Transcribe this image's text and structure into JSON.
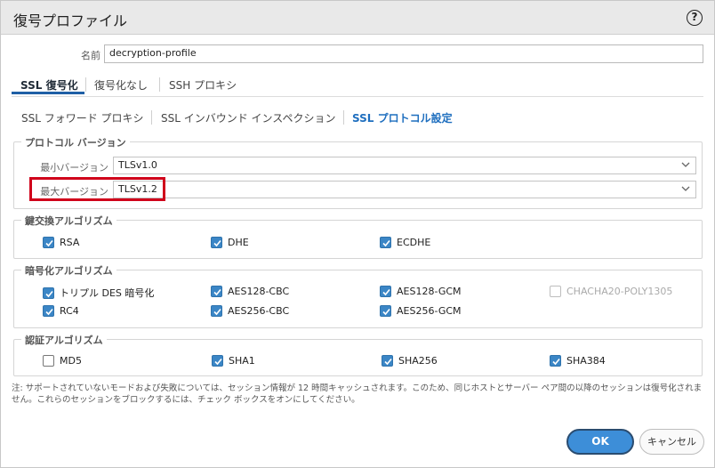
{
  "dialog": {
    "title": "復号プロファイル"
  },
  "name_field": {
    "label": "名前",
    "value": "decryption-profile"
  },
  "tabs": [
    "SSL 復号化",
    "復号化なし",
    "SSH プロキシ"
  ],
  "subtabs": [
    "SSL フォワード プロキシ",
    "SSL インバウンド インスペクション",
    "SSL プロトコル設定"
  ],
  "protocol_version": {
    "title": "プロトコル バージョン",
    "min_label": "最小バージョン",
    "min_value": "TLSv1.0",
    "max_label": "最大バージョン",
    "max_value": "TLSv1.2"
  },
  "key_exchange": {
    "title": "鍵交換アルゴリズム",
    "items": [
      {
        "label": "RSA",
        "checked": true
      },
      {
        "label": "DHE",
        "checked": true
      },
      {
        "label": "ECDHE",
        "checked": true
      }
    ]
  },
  "encryption": {
    "title": "暗号化アルゴリズム",
    "items": [
      {
        "label": "トリプル DES 暗号化",
        "checked": true
      },
      {
        "label": "AES128-CBC",
        "checked": true
      },
      {
        "label": "AES128-GCM",
        "checked": true
      },
      {
        "label": "CHACHA20-POLY1305",
        "checked": false,
        "disabled": true
      },
      {
        "label": "RC4",
        "checked": true
      },
      {
        "label": "AES256-CBC",
        "checked": true
      },
      {
        "label": "AES256-GCM",
        "checked": true
      }
    ]
  },
  "authentication": {
    "title": "認証アルゴリズム",
    "items": [
      {
        "label": "MD5",
        "checked": false
      },
      {
        "label": "SHA1",
        "checked": true
      },
      {
        "label": "SHA256",
        "checked": true
      },
      {
        "label": "SHA384",
        "checked": true
      }
    ]
  },
  "note": "注: サポートされていないモードおよび失敗については、セッション情報が 12 時間キャッシュされます。このため、同じホストとサーバー ペア間の以降のセッションは復号化されません。これらのセッションをブロックするには、チェック ボックスをオンにしてください。",
  "buttons": {
    "ok": "OK",
    "cancel": "キャンセル"
  },
  "colors": {
    "accent": "#3d8ed8",
    "highlight": "#d0021b",
    "checkbox": "#3b86c6"
  }
}
